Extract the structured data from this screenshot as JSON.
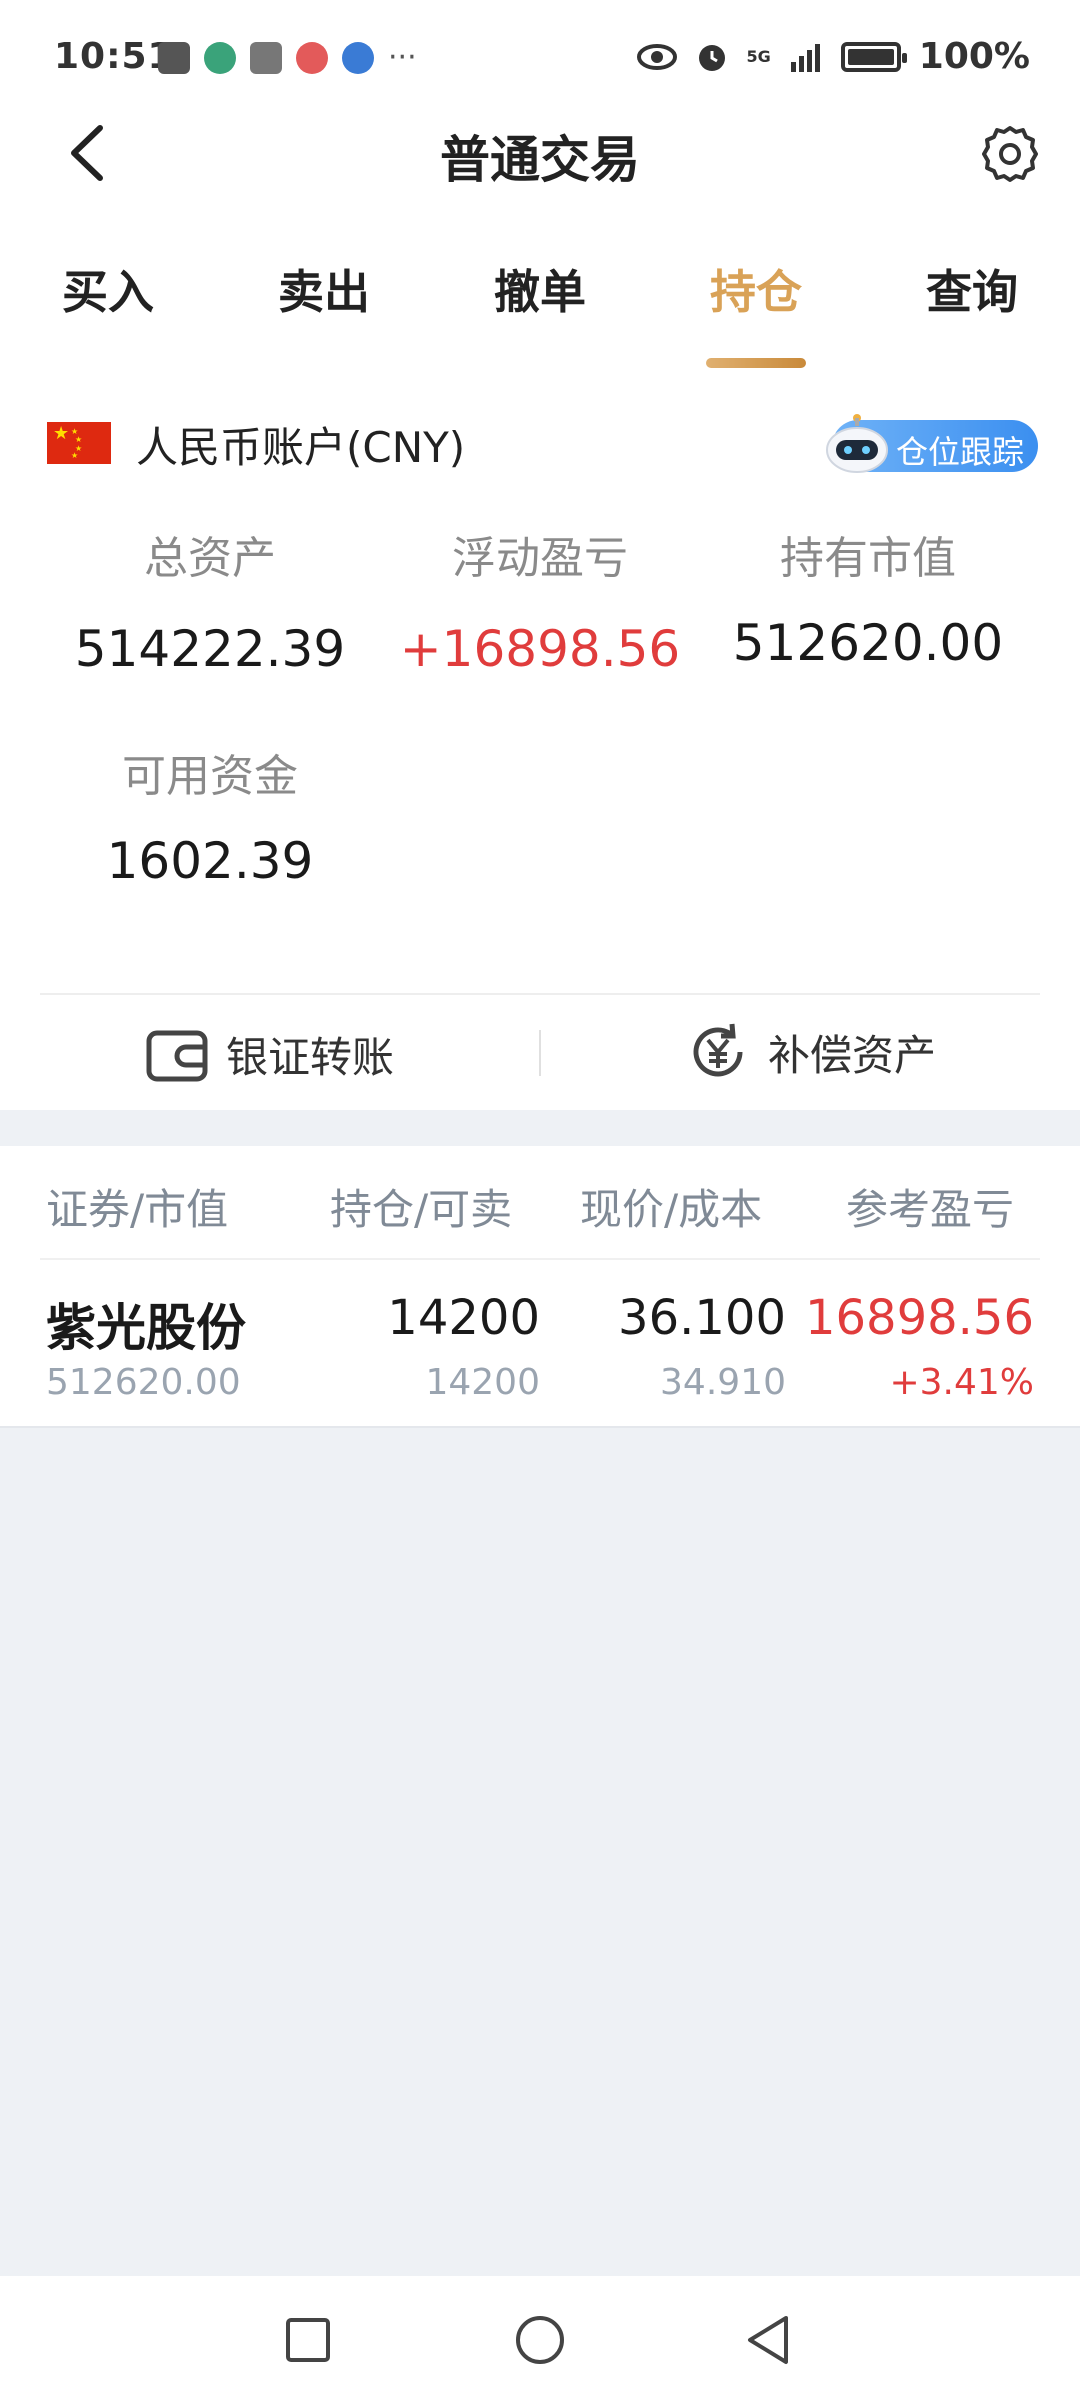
{
  "status": {
    "time": "10:51",
    "network": "5G",
    "battery": "100%"
  },
  "header": {
    "title": "普通交易"
  },
  "tabs": [
    {
      "label": "买入",
      "active": false
    },
    {
      "label": "卖出",
      "active": false
    },
    {
      "label": "撤单",
      "active": false
    },
    {
      "label": "持仓",
      "active": true
    },
    {
      "label": "查询",
      "active": false
    }
  ],
  "account": {
    "label": "人民币账户(CNY)",
    "track_button": "仓位跟踪",
    "total_assets_label": "总资产",
    "total_assets": "514222.39",
    "floating_pl_label": "浮动盈亏",
    "floating_pl": "+16898.56",
    "market_value_label": "持有市值",
    "market_value": "512620.00",
    "available_label": "可用资金",
    "available": "1602.39"
  },
  "actions": {
    "transfer": "银证转账",
    "compensation": "补偿资产"
  },
  "table": {
    "headers": [
      "证券/市值",
      "持仓/可卖",
      "现价/成本",
      "参考盈亏"
    ],
    "rows": [
      {
        "name": "紫光股份",
        "market_value": "512620.00",
        "position": "14200",
        "sellable": "14200",
        "price": "36.100",
        "cost": "34.910",
        "pl": "16898.56",
        "pl_pct": "+3.41%"
      }
    ]
  },
  "colors": {
    "accent": "#d9a257",
    "up": "#e03c3c",
    "muted": "#808a96",
    "background_grey": "#eef1f5"
  }
}
